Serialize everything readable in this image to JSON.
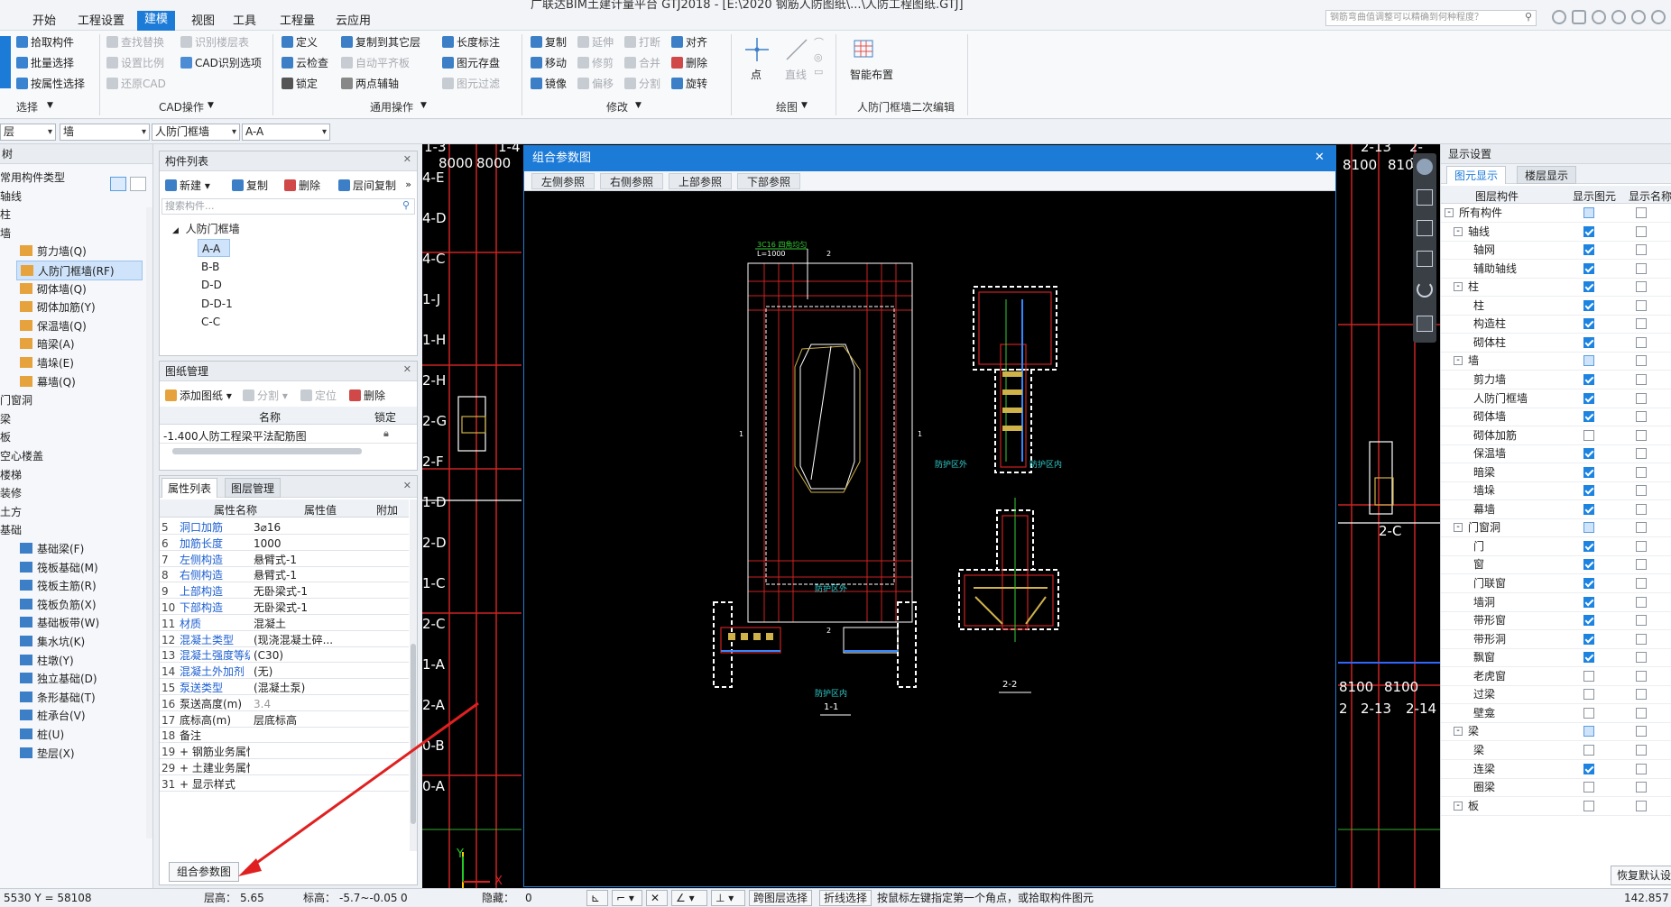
{
  "window": {
    "title_fragment": "广联达BIM土建计量平台 GTJ2018 - [E:\\2020 钢筋人防图纸\\...\\人防工程图纸.GTJ]"
  },
  "menu": {
    "items": [
      "开始",
      "工程设置",
      "建模",
      "视图",
      "工具",
      "工程量",
      "云应用"
    ],
    "active": "建模",
    "search_placeholder": "钢筋弯曲值调整可以精确到何种程度？"
  },
  "ribbon": {
    "select": {
      "items": [
        "拾取构件",
        "批量选择",
        "按属性选择"
      ],
      "group": "选择"
    },
    "cad": {
      "items": [
        "查找替换",
        "识别楼层表",
        "设置比例",
        "CAD识别选项",
        "还原CAD"
      ],
      "group": "CAD操作"
    },
    "common": {
      "items": [
        "定义",
        "复制到其它层",
        "长度标注",
        "云检查",
        "自动平齐板",
        "图元存盘",
        "锁定",
        "两点辅轴",
        "图元过滤"
      ],
      "group": "通用操作"
    },
    "modify": {
      "items": [
        "复制",
        "延伸",
        "打断",
        "对齐",
        "移动",
        "修剪",
        "合并",
        "删除",
        "镜像",
        "偏移",
        "分割",
        "旋转"
      ],
      "group": "修改"
    },
    "draw": {
      "items": [
        "点",
        "直线"
      ],
      "group": "绘图"
    },
    "smart": {
      "item": "智能布置",
      "group": "人防门框墙二次编辑"
    }
  },
  "combos": {
    "layer": "层",
    "type": "墙",
    "category": "人防门框墙",
    "name": "A-A"
  },
  "leftnav": {
    "header": "树",
    "items": [
      "常用构件类型",
      "轴线",
      "柱",
      "墙",
      "剪力墙(Q)",
      "人防门框墙(RF)",
      "砌体墙(Q)",
      "砌体加筋(Y)",
      "保温墙(Q)",
      "暗梁(A)",
      "墙垛(E)",
      "幕墙(Q)",
      "门窗洞",
      "梁",
      "板",
      "空心楼盖",
      "楼梯",
      "装修",
      "土方",
      "基础",
      "基础梁(F)",
      "筏板基础(M)",
      "筏板主筋(R)",
      "筏板负筋(X)",
      "基础板带(W)",
      "集水坑(K)",
      "柱墩(Y)",
      "独立基础(D)",
      "条形基础(T)",
      "桩承台(V)",
      "桩(U)",
      "垫层(X)"
    ],
    "selected": "人防门框墙(RF)"
  },
  "component_list": {
    "header": "构件列表",
    "tools": [
      "新建",
      "复制",
      "删除",
      "层间复制"
    ],
    "search_placeholder": "搜索构件...",
    "group": "人防门框墙",
    "items": [
      "A-A",
      "B-B",
      "D-D",
      "D-D-1",
      "C-C"
    ],
    "selected": "A-A"
  },
  "drawing_mgmt": {
    "header": "图纸管理",
    "tools": [
      "添加图纸",
      "分割",
      "定位",
      "删除"
    ],
    "col_name": "名称",
    "col_lock": "锁定",
    "row": "-1.400人防工程梁平法配筋图"
  },
  "properties": {
    "tabs": [
      "属性列表",
      "图层管理"
    ],
    "cols": [
      "属性名称",
      "属性值",
      "附加"
    ],
    "rows": [
      {
        "n": "5",
        "name": "洞口加筋",
        "val": "3⌀16",
        "blue": true,
        "cb": "unchecked"
      },
      {
        "n": "6",
        "name": "加筋长度",
        "val": "1000",
        "blue": true,
        "cb": "unchecked"
      },
      {
        "n": "7",
        "name": "左侧构造",
        "val": "悬臂式-1",
        "blue": true,
        "cb": "unchecked"
      },
      {
        "n": "8",
        "name": "右侧构造",
        "val": "悬臂式-1",
        "blue": true,
        "cb": "unchecked"
      },
      {
        "n": "9",
        "name": "上部构造",
        "val": "无卧梁式-1",
        "blue": true,
        "cb": "unchecked"
      },
      {
        "n": "10",
        "name": "下部构造",
        "val": "无卧梁式-1",
        "blue": true,
        "cb": "unchecked"
      },
      {
        "n": "11",
        "name": "材质",
        "val": "混凝土",
        "blue": true,
        "cb": "unchecked"
      },
      {
        "n": "12",
        "name": "混凝土类型",
        "val": "(现浇混凝土碎...",
        "blue": true,
        "cb": "unchecked"
      },
      {
        "n": "13",
        "name": "混凝土强度等级",
        "val": "(C30)",
        "blue": true,
        "cb": "unchecked"
      },
      {
        "n": "14",
        "name": "混凝土外加剂",
        "val": "(无)",
        "blue": true,
        "cb": "none"
      },
      {
        "n": "15",
        "name": "泵送类型",
        "val": "(混凝土泵)",
        "blue": true,
        "cb": "none"
      },
      {
        "n": "16",
        "name": "泵送高度(m)",
        "val": "3.4",
        "blue": false,
        "cb": "none"
      },
      {
        "n": "17",
        "name": "底标高(m)",
        "val": "层底标高",
        "blue": false,
        "cb": "unchecked"
      },
      {
        "n": "18",
        "name": "备注",
        "val": "",
        "blue": false,
        "cb": "unchecked"
      },
      {
        "n": "19",
        "name": "+ 钢筋业务属性",
        "val": "",
        "blue": false,
        "cb": "none"
      },
      {
        "n": "29",
        "name": "+ 土建业务属性",
        "val": "",
        "blue": false,
        "cb": "none"
      },
      {
        "n": "31",
        "name": "+ 显示样式",
        "val": "",
        "blue": false,
        "cb": "none"
      }
    ],
    "button": "组合参数图"
  },
  "canvas": {
    "top_labels": [
      "1-3",
      "8000",
      "8000",
      "1-4"
    ],
    "left_labels": [
      "4-E",
      "4-D",
      "4-C",
      "1-J",
      "1-H",
      "2-H",
      "2-G",
      "2-F",
      "1-D",
      "2-D",
      "1-C",
      "2-C",
      "1-A",
      "2-A",
      "0-B",
      "0-A"
    ],
    "right_labels": [
      "2-13",
      "8100",
      "8100",
      "2-14",
      "2-C"
    ],
    "bottom_right": [
      "8100",
      "8100",
      "2",
      "2-13",
      "2-14"
    ],
    "axis_y": "Y",
    "axis_x": "X"
  },
  "dialog": {
    "title": "组合参数图",
    "close": "✕",
    "tabs": [
      "左侧参照",
      "右侧参照",
      "上部参照",
      "下部参照"
    ],
    "labels": {
      "rebar_note": "3C16 四角均匀",
      "length": "L=1000",
      "protect_out_1": "防护区外",
      "protect_in_1": "防护区内",
      "protect_out_2": "防护区外",
      "protect_in_2": "防护区内",
      "sec1": "1-1",
      "sec2": "2-2",
      "cut_l": "1",
      "cut_r": "1",
      "cut_t": "2",
      "cut_b": "2"
    }
  },
  "right_panel": {
    "header": "显示设置",
    "tabs": [
      "图元显示",
      "楼层显示"
    ],
    "cols": [
      "图层构件",
      "显示图元",
      "显示名称"
    ],
    "rows": [
      {
        "l": 0,
        "t": "所有构件",
        "s": "partial",
        "n": "unchecked",
        "ex": "-"
      },
      {
        "l": 1,
        "t": "轴线",
        "s": "checked",
        "n": "unchecked",
        "ex": "-"
      },
      {
        "l": 2,
        "t": "轴网",
        "s": "checked",
        "n": "unchecked"
      },
      {
        "l": 2,
        "t": "辅助轴线",
        "s": "checked",
        "n": "unchecked"
      },
      {
        "l": 1,
        "t": "柱",
        "s": "checked",
        "n": "unchecked",
        "ex": "-"
      },
      {
        "l": 2,
        "t": "柱",
        "s": "checked",
        "n": "unchecked"
      },
      {
        "l": 2,
        "t": "构造柱",
        "s": "checked",
        "n": "unchecked"
      },
      {
        "l": 2,
        "t": "砌体柱",
        "s": "checked",
        "n": "unchecked"
      },
      {
        "l": 1,
        "t": "墙",
        "s": "partial",
        "n": "unchecked",
        "ex": "-"
      },
      {
        "l": 2,
        "t": "剪力墙",
        "s": "checked",
        "n": "unchecked"
      },
      {
        "l": 2,
        "t": "人防门框墙",
        "s": "checked",
        "n": "unchecked"
      },
      {
        "l": 2,
        "t": "砌体墙",
        "s": "checked",
        "n": "unchecked"
      },
      {
        "l": 2,
        "t": "砌体加筋",
        "s": "unchecked",
        "n": "unchecked"
      },
      {
        "l": 2,
        "t": "保温墙",
        "s": "checked",
        "n": "unchecked"
      },
      {
        "l": 2,
        "t": "暗梁",
        "s": "checked",
        "n": "unchecked"
      },
      {
        "l": 2,
        "t": "墙垛",
        "s": "checked",
        "n": "unchecked"
      },
      {
        "l": 2,
        "t": "幕墙",
        "s": "checked",
        "n": "unchecked"
      },
      {
        "l": 1,
        "t": "门窗洞",
        "s": "partial",
        "n": "unchecked",
        "ex": "-"
      },
      {
        "l": 2,
        "t": "门",
        "s": "checked",
        "n": "unchecked"
      },
      {
        "l": 2,
        "t": "窗",
        "s": "checked",
        "n": "unchecked"
      },
      {
        "l": 2,
        "t": "门联窗",
        "s": "checked",
        "n": "unchecked"
      },
      {
        "l": 2,
        "t": "墙洞",
        "s": "checked",
        "n": "unchecked"
      },
      {
        "l": 2,
        "t": "带形窗",
        "s": "checked",
        "n": "unchecked"
      },
      {
        "l": 2,
        "t": "带形洞",
        "s": "checked",
        "n": "unchecked"
      },
      {
        "l": 2,
        "t": "飘窗",
        "s": "checked",
        "n": "unchecked"
      },
      {
        "l": 2,
        "t": "老虎窗",
        "s": "unchecked",
        "n": "unchecked"
      },
      {
        "l": 2,
        "t": "过梁",
        "s": "unchecked",
        "n": "unchecked"
      },
      {
        "l": 2,
        "t": "壁龛",
        "s": "unchecked",
        "n": "unchecked"
      },
      {
        "l": 1,
        "t": "梁",
        "s": "partial",
        "n": "unchecked",
        "ex": "-"
      },
      {
        "l": 2,
        "t": "梁",
        "s": "unchecked",
        "n": "unchecked"
      },
      {
        "l": 2,
        "t": "连梁",
        "s": "checked",
        "n": "unchecked"
      },
      {
        "l": 2,
        "t": "圈梁",
        "s": "unchecked",
        "n": "unchecked"
      },
      {
        "l": 1,
        "t": "板",
        "s": "unchecked",
        "n": "unchecked",
        "ex": "-"
      }
    ],
    "restore": "恢复默认设"
  },
  "status": {
    "coords": "5530 Y = 58108",
    "floor_h_label": "层高：",
    "floor_h": "5.65",
    "elev_label": "标高：",
    "elev": "-5.7~-0.05",
    "zero": "0",
    "hidden_label": "隐藏：",
    "hidden": "0",
    "btns": [
      "跨图层选择",
      "折线选择"
    ],
    "hint": "按鼠标左键指定第一个角点，或拾取构件图元",
    "right": "142.857"
  }
}
